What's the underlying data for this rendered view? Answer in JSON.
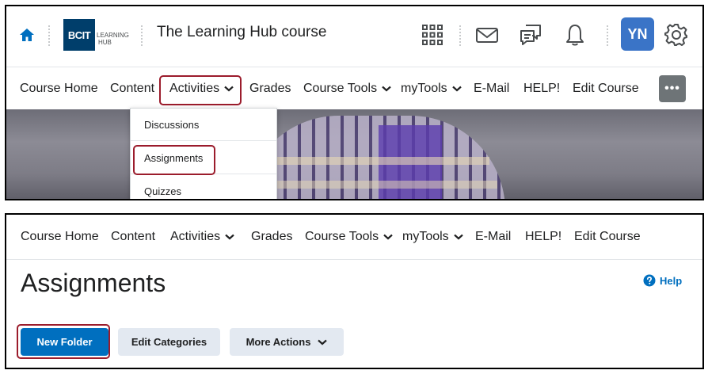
{
  "header": {
    "course_title": "The Learning Hub course",
    "logo_text": "BCIT",
    "logo_sub_line1": "LEARNING",
    "logo_sub_line2": "HUB",
    "avatar_initials": "YN"
  },
  "nav": {
    "items": [
      "Course Home",
      "Content",
      "Activities",
      "Grades",
      "Course Tools",
      "myTools",
      "E-Mail",
      "HELP!",
      "Edit Course"
    ],
    "more_label": "•••"
  },
  "activities_menu": {
    "items": [
      "Discussions",
      "Assignments",
      "Quizzes"
    ]
  },
  "page": {
    "title": "Assignments",
    "help_label": "Help"
  },
  "toolbar": {
    "new_folder": "New Folder",
    "edit_categories": "Edit Categories",
    "more_actions": "More Actions"
  },
  "colors": {
    "accent": "#006fbf",
    "highlight": "#9b1c2c",
    "avatar": "#3a74c7",
    "logo": "#003e6b"
  },
  "icons": [
    "home-icon",
    "apps-grid-icon",
    "mail-icon",
    "chat-icon",
    "bell-icon",
    "gear-icon",
    "chevron-down-icon",
    "help-icon"
  ]
}
